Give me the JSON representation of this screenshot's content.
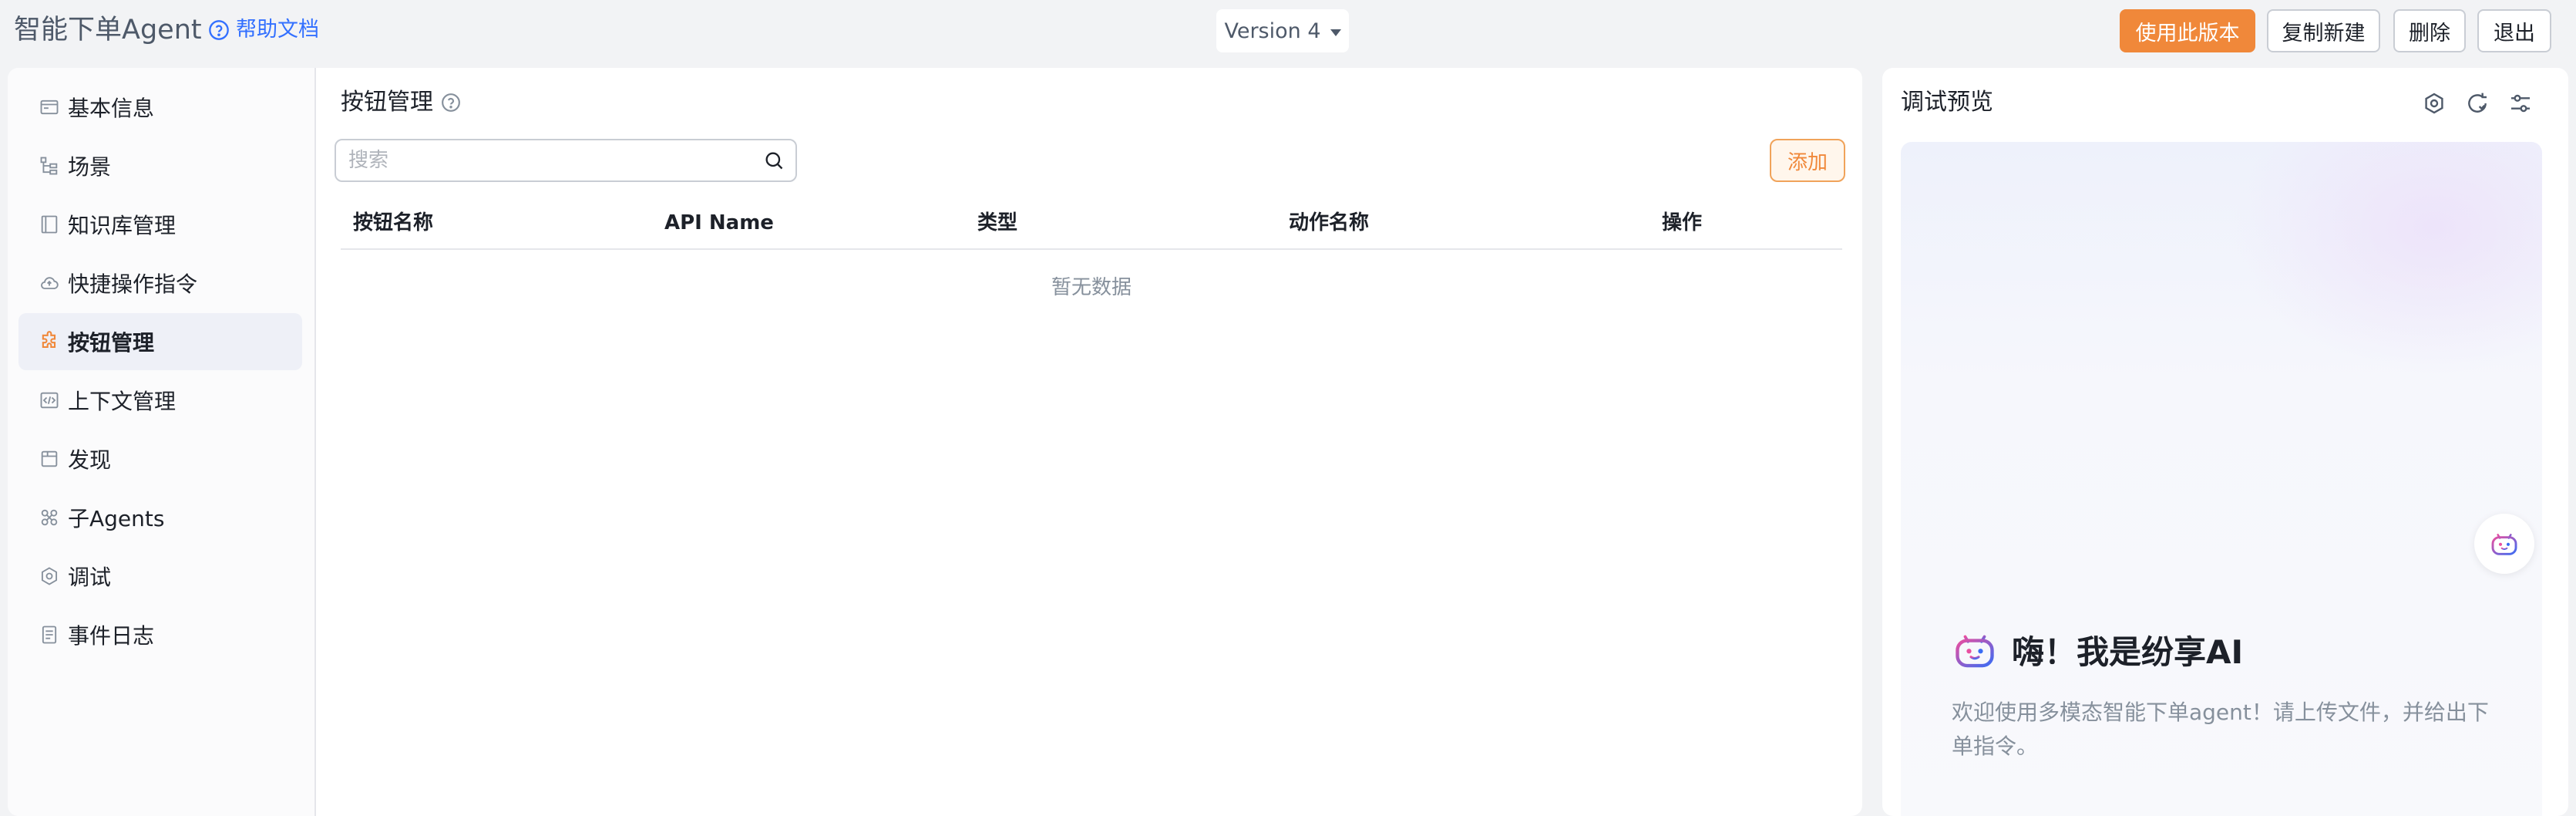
{
  "header": {
    "app_title": "智能下单Agent",
    "help_label": "帮助文档",
    "version_label": "Version 4",
    "buttons": {
      "publish": "使用此版本",
      "copy_new": "复制新建",
      "delete": "删除",
      "exit": "退出"
    }
  },
  "sidebar": {
    "items": [
      {
        "label": "基本信息",
        "icon": "card-icon"
      },
      {
        "label": "场景",
        "icon": "tree-icon"
      },
      {
        "label": "知识库管理",
        "icon": "book-icon"
      },
      {
        "label": "快捷操作指令",
        "icon": "cloud-icon"
      },
      {
        "label": "按钮管理",
        "icon": "puzzle-icon",
        "active": true
      },
      {
        "label": "上下文管理",
        "icon": "code-icon"
      },
      {
        "label": "发现",
        "icon": "box-icon"
      },
      {
        "label": "子Agents",
        "icon": "link-icon"
      },
      {
        "label": "调试",
        "icon": "gear-icon"
      },
      {
        "label": "事件日志",
        "icon": "log-icon"
      }
    ]
  },
  "main": {
    "section_title": "按钮管理",
    "search_placeholder": "搜索",
    "add_label": "添加",
    "table": {
      "columns": [
        "按钮名称",
        "API Name",
        "类型",
        "动作名称",
        "操作"
      ],
      "rows": [],
      "empty_text": "暂无数据"
    }
  },
  "preview": {
    "title": "调试预览",
    "greeting_title": "嗨！我是纷享AI",
    "greeting_desc": "欢迎使用多模态智能下单agent！请上传文件，并给出下单指令。"
  },
  "colors": {
    "accent": "#f0883a",
    "link": "#3370ff",
    "bot_gradient_start": "#e94fa0",
    "bot_gradient_end": "#3a6cf4"
  }
}
